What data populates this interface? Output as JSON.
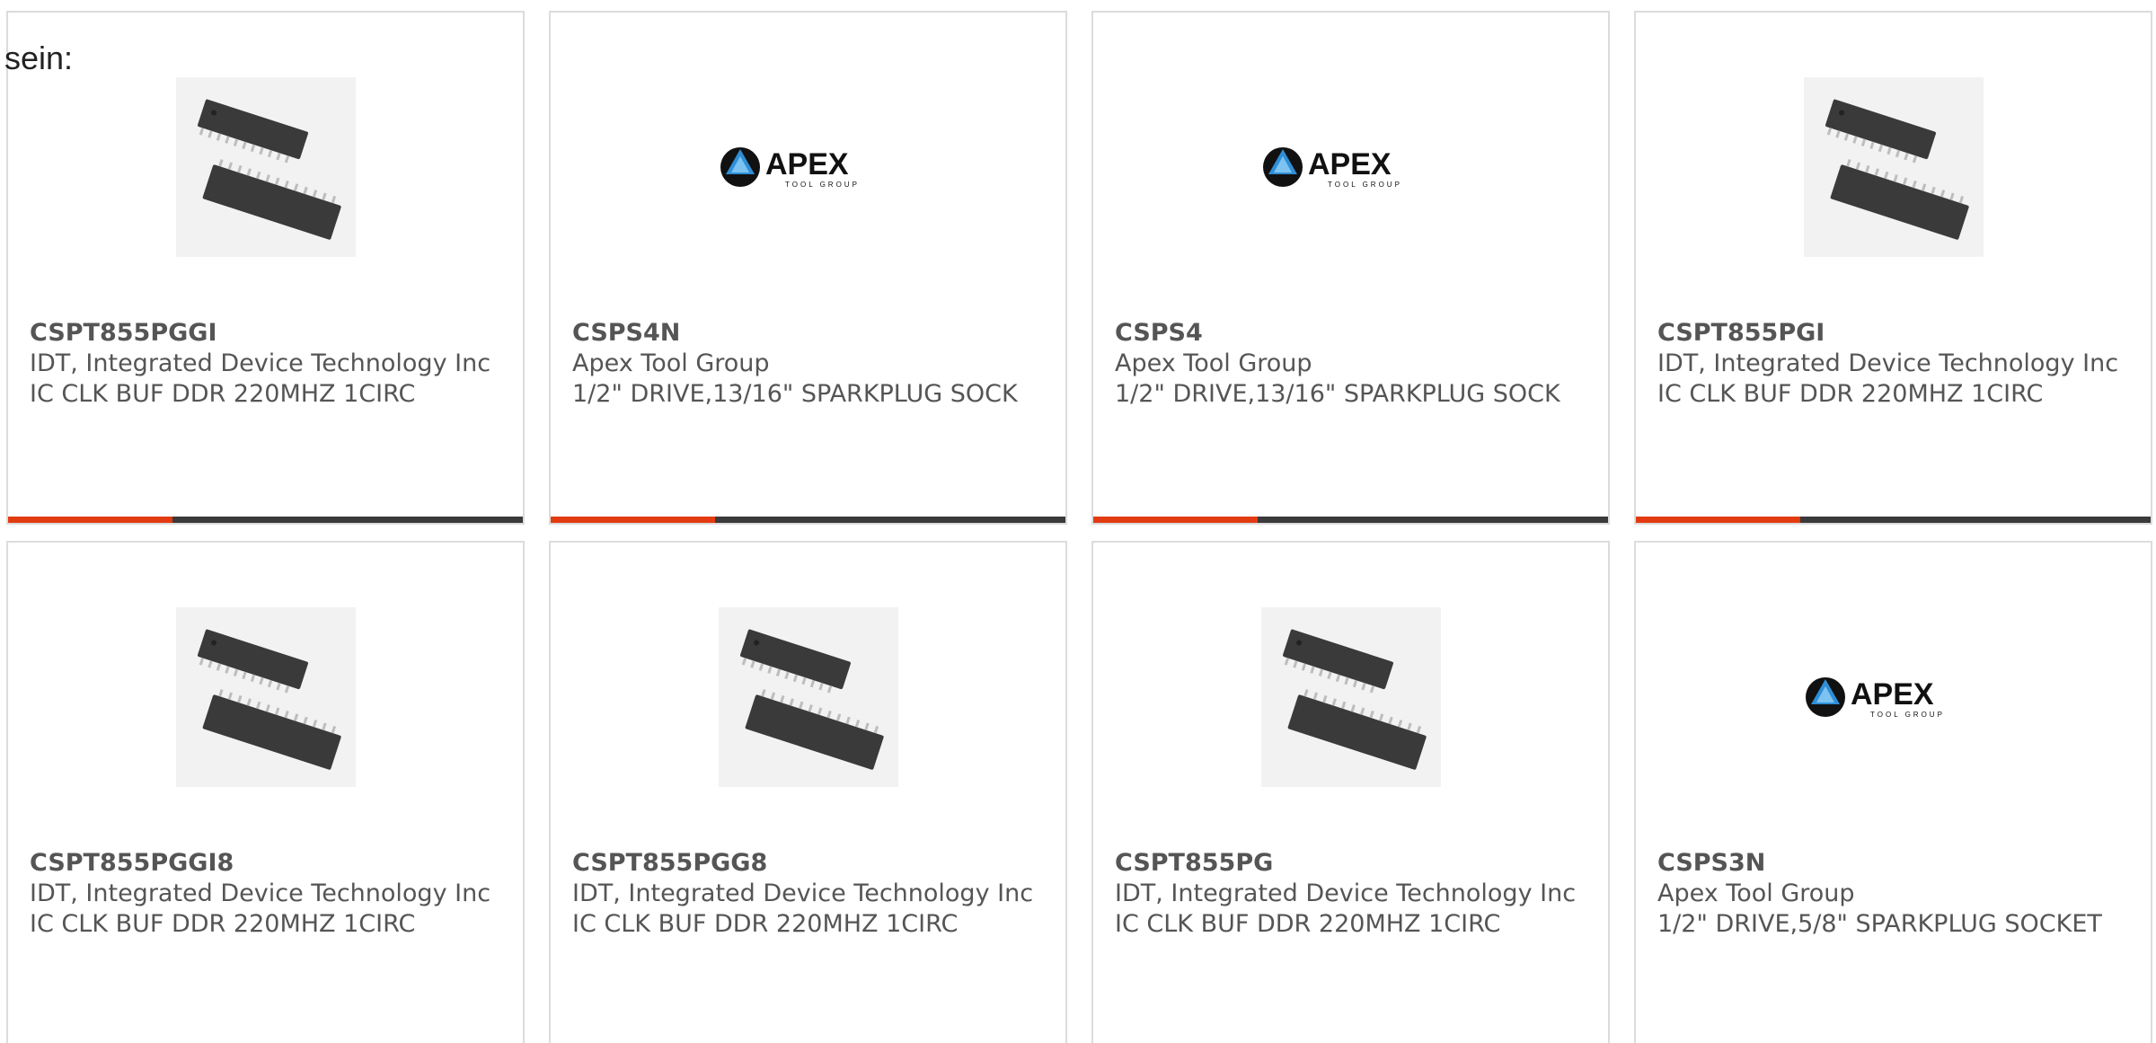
{
  "intro_text": "sein:",
  "colors": {
    "accent": "#e23b12",
    "bar": "#3a3a3a",
    "border": "#dcdcdc",
    "text": "#555555"
  },
  "cards": [
    {
      "part_number": "CSPT855PGGI",
      "manufacturer": "IDT, Integrated Device Technology Inc",
      "description": "IC CLK BUF DDR 220MHZ 1CIRC",
      "image_icon": "ic-chip-image"
    },
    {
      "part_number": "CSPS4N",
      "manufacturer": "Apex Tool Group",
      "description": "1/2\" DRIVE,13/16\" SPARKPLUG SOCK",
      "image_icon": "apex-logo"
    },
    {
      "part_number": "CSPS4",
      "manufacturer": "Apex Tool Group",
      "description": "1/2\" DRIVE,13/16\" SPARKPLUG SOCK",
      "image_icon": "apex-logo"
    },
    {
      "part_number": "CSPT855PGI",
      "manufacturer": "IDT, Integrated Device Technology Inc",
      "description": "IC CLK BUF DDR 220MHZ 1CIRC",
      "image_icon": "ic-chip-image"
    },
    {
      "part_number": "CSPT855PGGI8",
      "manufacturer": "IDT, Integrated Device Technology Inc",
      "description": "IC CLK BUF DDR 220MHZ 1CIRC",
      "image_icon": "ic-chip-image"
    },
    {
      "part_number": "CSPT855PGG8",
      "manufacturer": "IDT, Integrated Device Technology Inc",
      "description": "IC CLK BUF DDR 220MHZ 1CIRC",
      "image_icon": "ic-chip-image"
    },
    {
      "part_number": "CSPT855PG",
      "manufacturer": "IDT, Integrated Device Technology Inc",
      "description": "IC CLK BUF DDR 220MHZ 1CIRC",
      "image_icon": "ic-chip-image"
    },
    {
      "part_number": "CSPS3N",
      "manufacturer": "Apex Tool Group",
      "description": "1/2\" DRIVE,5/8\" SPARKPLUG SOCKET",
      "image_icon": "apex-logo"
    }
  ],
  "apex_logo": {
    "word": "APEX",
    "tagline": "TOOL GROUP"
  }
}
